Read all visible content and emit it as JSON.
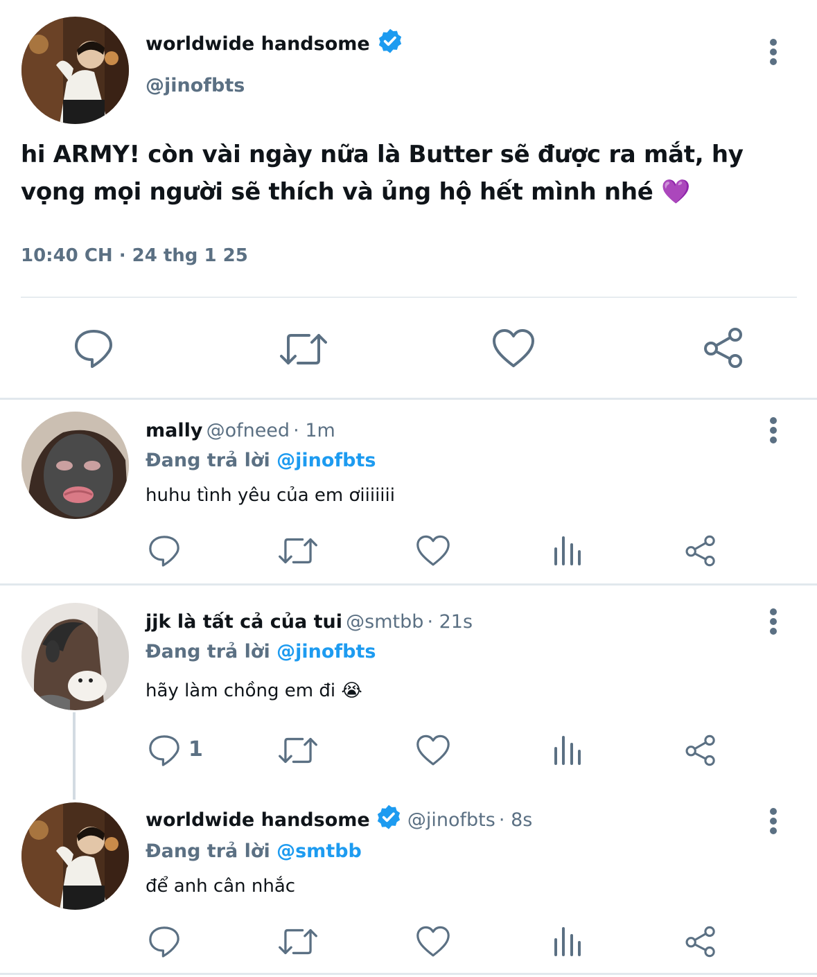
{
  "main_tweet": {
    "author_name": "worldwide handsome",
    "handle": "@jinofbts",
    "text": "hi ARMY! còn vài ngày nữa là Butter sẽ được ra mắt, hy vọng mọi người sẽ thích và ủng hộ hết mình nhé 💜",
    "timestamp": "10:40 CH · 24 thg 1 25",
    "avatar_icon": "avatar-photo-icon",
    "verified_icon": "verified-badge-icon"
  },
  "replies": [
    {
      "author_name": "mally",
      "handle": "@ofneed",
      "time": "· 1m",
      "reply_label": "Đang trả lời",
      "mention": "@jinofbts",
      "text": "huhu tình yêu của em ơiiiiiii",
      "reply_count": ""
    },
    {
      "author_name": "jjk là tất cả của tui",
      "handle": "@smtbb",
      "time": "· 21s",
      "reply_label": "Đang trả lời",
      "mention": "@jinofbts",
      "text": "hãy làm chồng em đi 😭",
      "reply_count": "1"
    },
    {
      "author_name": "worldwide handsome",
      "handle": "@jinofbts",
      "time": "· 8s",
      "reply_label": "Đang trả lời",
      "mention": "@smtbb",
      "text": "để anh cân nhắc",
      "reply_count": ""
    }
  ],
  "colors": {
    "text": "#0f1419",
    "muted": "#5b7083",
    "accent": "#1d9bf0",
    "divider": "#e6ecf0"
  }
}
